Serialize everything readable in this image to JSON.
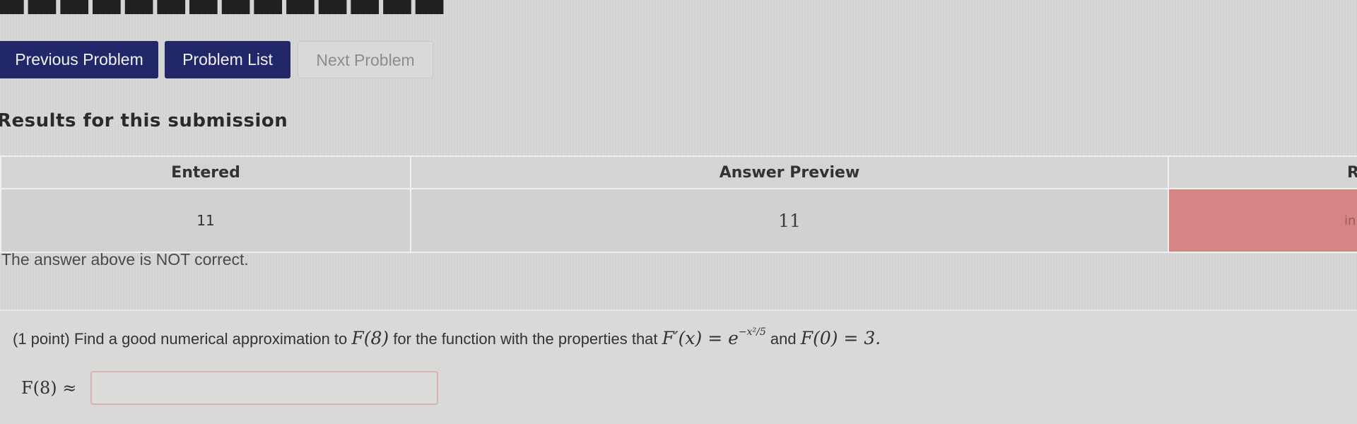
{
  "nav": {
    "previous_label": "Previous Problem",
    "list_label": "Problem List",
    "next_label": "Next Problem"
  },
  "results": {
    "heading": "Results for this submission",
    "columns": [
      "Entered",
      "Answer Preview",
      "R"
    ],
    "row": {
      "entered": "11",
      "preview": "11",
      "result": "in"
    },
    "feedback": "The answer above is NOT correct."
  },
  "problem": {
    "points": "(1 point)",
    "text_before": "Find a good numerical approximation to",
    "f8": "F(8)",
    "text_middle": "for the function with the properties that",
    "derivative_lhs": "F′(x) = e",
    "exponent": "−x²/5",
    "text_and": "and",
    "initial": "F(0) = 3.",
    "answer_label": "F(8) ≈",
    "answer_value": ""
  },
  "colors": {
    "nav_primary": "#22276a",
    "nav_disabled": "#d9d9d9",
    "incorrect": "#d58585"
  }
}
